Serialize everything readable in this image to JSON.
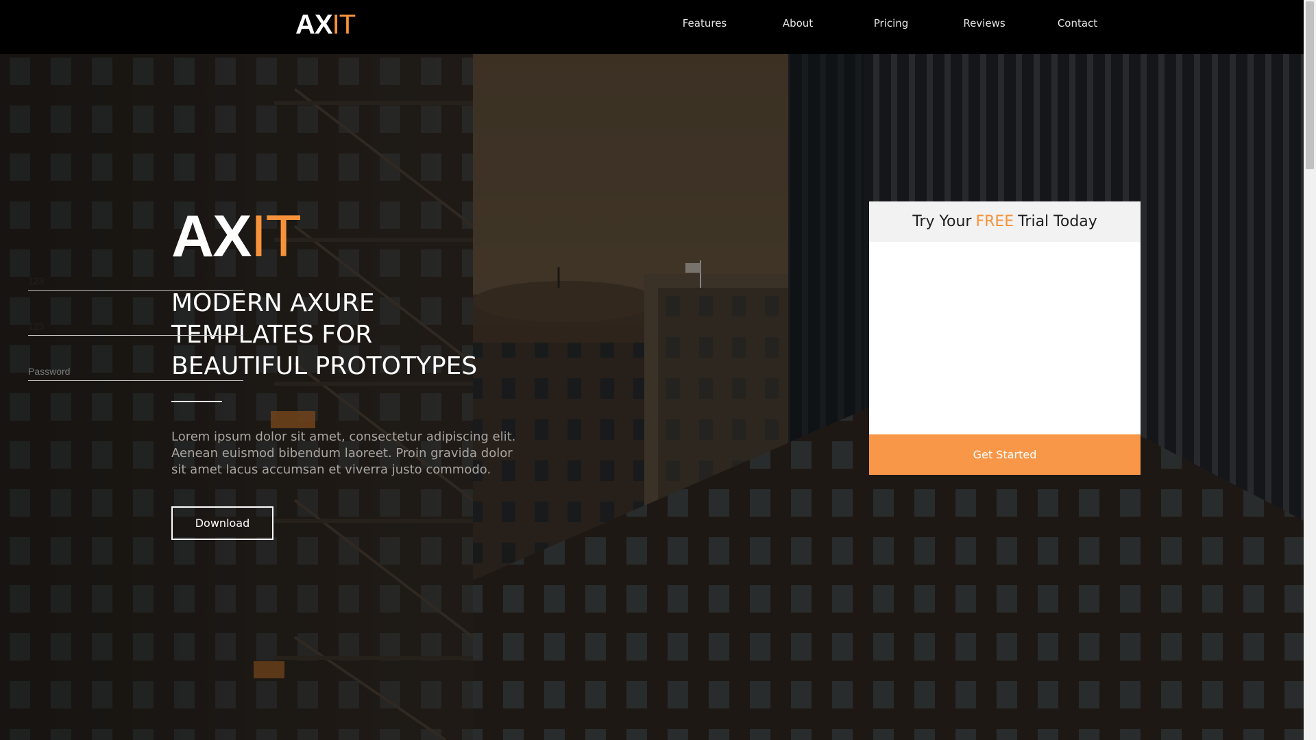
{
  "brand": {
    "logo_prefix": "AX",
    "logo_accent": "IT",
    "accent_color": "#f7923b"
  },
  "nav": {
    "items": [
      "Features",
      "About",
      "Pricing",
      "Reviews",
      "Contact"
    ]
  },
  "hero": {
    "logo_prefix": "AX",
    "logo_accent": "IT",
    "title_line1": "MODERN AXURE",
    "title_line2": "TEMPLATES FOR",
    "title_line3": "BEAUTIFUL PROTOTYPES",
    "description": "Lorem ipsum dolor sit amet, consectetur adipiscing elit. Aenean euismod bibendum laoreet. Proin gravida dolor sit amet lacus accumsan et viverra justo commodo.",
    "download_label": "Download"
  },
  "trial_form": {
    "heading_before": "Try Your",
    "heading_accent": "FREE",
    "heading_after": "Trial Today",
    "field1_value": "123",
    "field2_value": "123",
    "password_placeholder": "Password",
    "submit_label": "Get Started",
    "button_color": "#f99748"
  }
}
